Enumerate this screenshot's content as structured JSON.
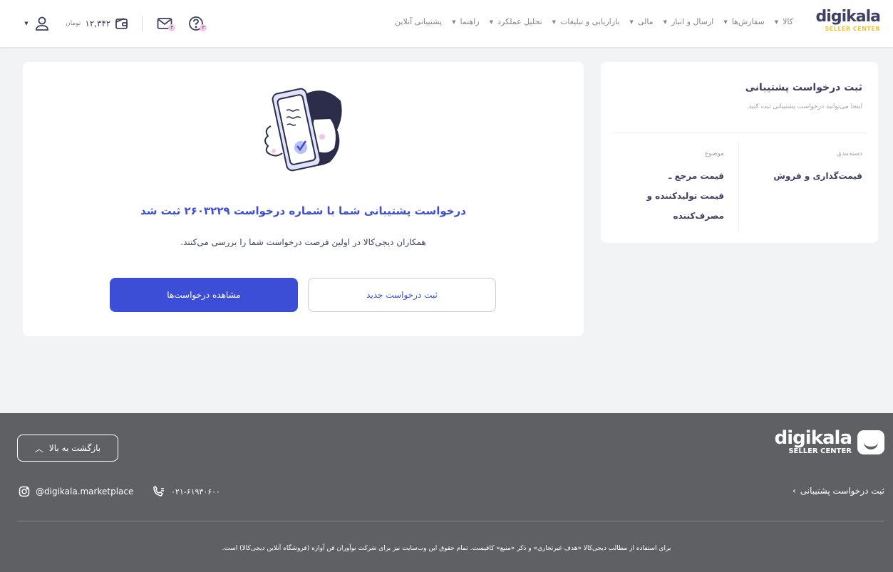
{
  "header": {
    "logo_word": "digikala",
    "logo_sub": "SELLER CENTER",
    "nav": [
      {
        "label": "کالا",
        "has_menu": true
      },
      {
        "label": "سفارش‌ها",
        "has_menu": true
      },
      {
        "label": "ارسال و انبار",
        "has_menu": true
      },
      {
        "label": "مالی",
        "has_menu": true
      },
      {
        "label": "بازاریابی و تبلیغات",
        "has_menu": true
      },
      {
        "label": "تحلیل عملکرد",
        "has_menu": true
      },
      {
        "label": "راهنما",
        "has_menu": true
      },
      {
        "label": "پشتیبانی آنلاین",
        "has_menu": false
      }
    ],
    "balance_value": "۱۲,۳۴۲",
    "balance_unit": "تومان",
    "mail_badge": "۲",
    "help_badge": "۲"
  },
  "success": {
    "title": "درخواست پشتیبانی شما با شماره درخواست ۲۶۰۳۲۲۹ ثبت شد",
    "subtitle": "همکاران دیجی‌کالا در اولین فرصت درخواست شما را بررسی می‌کنند.",
    "view_requests_label": "مشاهده درخواست‌ها",
    "new_request_label": "ثبت درخواست جدید"
  },
  "summary": {
    "title": "ثبت درخواست پشتیبانی",
    "description": "اینجا می‌توانید درخواست پشتیبانی ثبت کنید.",
    "category_label": "دسته‌بندی",
    "category_value": "قیمت‌گذاری و فروش",
    "topic_label": "موضوع",
    "topic_lines": [
      "قیمت مرجع ـ",
      "قیمت تولیدکننده و",
      "مصرف‌کننده"
    ]
  },
  "footer": {
    "back_to_top": "بازگشت به بالا",
    "logo_word": "digikala",
    "logo_sub": "SELLER CENTER",
    "instagram": "@digikala.marketplace",
    "phone": "۰۲۱-۶۱۹۳۰۶۰۰",
    "breadcrumb_link": "ثبت درخواست پشتیبانی",
    "copyright": "برای استفاده از مطالب دیجی‌کالا «هدف غیرتجاری» و ذکر «منبع» کافیست. تمام حقوق این وب‌سایت نیز برای شرکت نوآوران فن آوازه (فروشگاه آنلاین دیجی‌کالا) است."
  },
  "colors": {
    "primary": "#3b4ed5",
    "footer_bg": "#5f6064",
    "logo_accent": "#f0c228",
    "badge": "#f4c6e2"
  }
}
